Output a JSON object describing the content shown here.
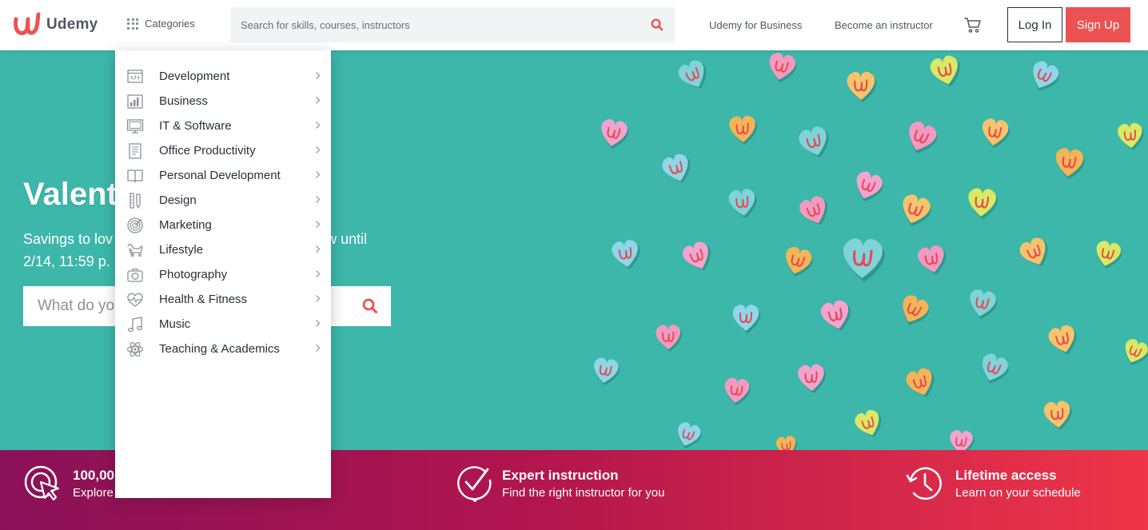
{
  "brand": {
    "name": "Udemy",
    "color": "#ec5252"
  },
  "header": {
    "categories_label": "Categories",
    "search_placeholder": "Search for skills, courses, instructors",
    "business_link": "Udemy for Business",
    "instructor_link": "Become an instructor",
    "cart_icon": "cart-icon",
    "login_label": "Log In",
    "signup_label": "Sign Up"
  },
  "hero": {
    "title": "Valent",
    "subtitle": "Savings to lov                          ow until 2/14, 11:59 p.",
    "subtitle_line1_left": "Savings to lov",
    "subtitle_line1_right": "ow until",
    "subtitle_line2": "2/14, 11:59 p.",
    "search_placeholder": "What do yo",
    "background_color": "#3cb7aa"
  },
  "dropdown": {
    "items": [
      {
        "label": "Development",
        "icon": "code-icon"
      },
      {
        "label": "Business",
        "icon": "chart-icon"
      },
      {
        "label": "IT & Software",
        "icon": "monitor-icon"
      },
      {
        "label": "Office Productivity",
        "icon": "document-icon"
      },
      {
        "label": "Personal Development",
        "icon": "book-icon"
      },
      {
        "label": "Design",
        "icon": "pencil-ruler-icon"
      },
      {
        "label": "Marketing",
        "icon": "target-icon"
      },
      {
        "label": "Lifestyle",
        "icon": "dog-icon"
      },
      {
        "label": "Photography",
        "icon": "camera-icon"
      },
      {
        "label": "Health & Fitness",
        "icon": "heart-pulse-icon"
      },
      {
        "label": "Music",
        "icon": "music-note-icon"
      },
      {
        "label": "Teaching & Academics",
        "icon": "atom-icon"
      }
    ]
  },
  "features": [
    {
      "title": "100,00",
      "subtitle": "Explore",
      "icon": "cursor-click-icon"
    },
    {
      "title": "Expert instruction",
      "subtitle": "Find the right instructor for you",
      "icon": "check-badge-icon"
    },
    {
      "title": "Lifetime access",
      "subtitle": "Learn on your schedule",
      "icon": "history-clock-icon"
    }
  ]
}
